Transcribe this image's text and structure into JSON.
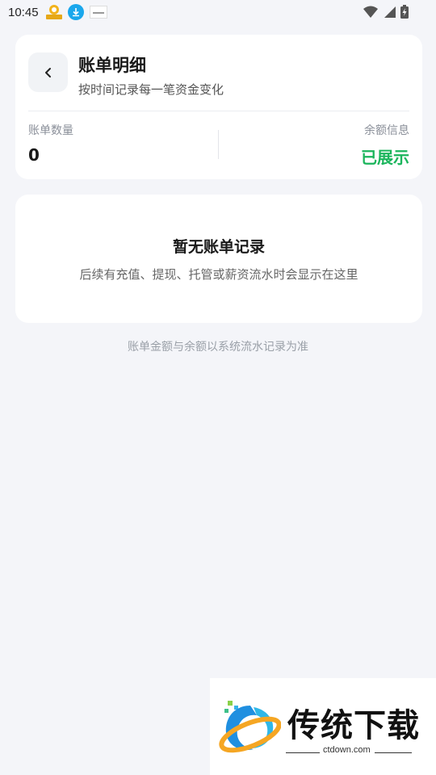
{
  "status_bar": {
    "time": "10:45",
    "icons_left": [
      "app-badge-icon",
      "download-icon",
      "notification-thumb-icon"
    ],
    "icons_right": [
      "wifi-icon",
      "cellular-signal-icon",
      "battery-charging-icon"
    ]
  },
  "header": {
    "back_glyph": "‹",
    "title": "账单明细",
    "subtitle": "按时间记录每一笔资金变化"
  },
  "stats": {
    "count_label": "账单数量",
    "count_value": "0",
    "balance_label": "余额信息",
    "balance_value": "已展示",
    "balance_color": "#1bb55c"
  },
  "empty_state": {
    "title": "暂无账单记录",
    "description": "后续有充值、提现、托管或薪资流水时会显示在这里"
  },
  "footnote": "账单金额与余额以系统流水记录为准",
  "watermark": {
    "brand": "传统下载",
    "domain": "ctdown.com"
  }
}
